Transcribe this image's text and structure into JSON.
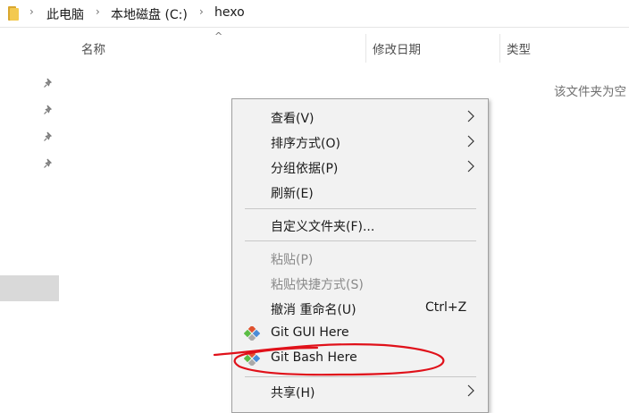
{
  "address": {
    "folder_icon": "folder-icon",
    "crumbs": [
      "此电脑",
      "本地磁盘 (C:)",
      "hexo"
    ],
    "separator": "›"
  },
  "columns": {
    "sort_caret": "^",
    "name": "名称",
    "date": "修改日期",
    "type": "类型"
  },
  "empty_message": "该文件夹为空",
  "context_menu": {
    "view": "查看(V)",
    "sort": "排序方式(O)",
    "group": "分组依据(P)",
    "refresh": "刷新(E)",
    "customize": "自定义文件夹(F)...",
    "paste": "粘贴(P)",
    "paste_shortcut": "粘贴快捷方式(S)",
    "undo_rename": "撤消 重命名(U)",
    "undo_shortcut": "Ctrl+Z",
    "git_gui": "Git GUI Here",
    "git_bash": "Git Bash Here",
    "share": "共享(H)"
  },
  "colors": {
    "menu_bg": "#f2f2f2",
    "git_orange": "#e0522f",
    "git_green": "#5bbd44",
    "git_blue": "#4a8cd8",
    "annotation_red": "#e0111a"
  }
}
